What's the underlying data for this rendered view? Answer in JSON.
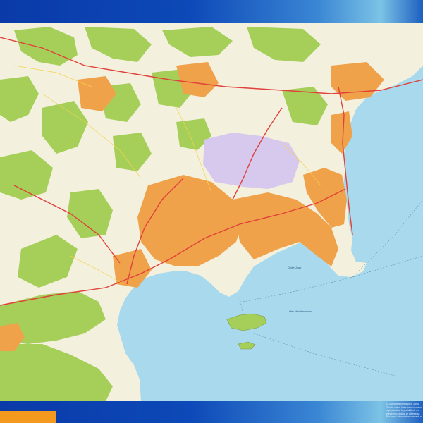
{
  "map": {
    "sea_labels": [
      "Golfe Juan",
      "Mer Méditerranée"
    ],
    "colors": {
      "sea": "#a9d9ec",
      "land": "#f3f0de",
      "forest": "#a6cf5a",
      "urban": "#f0a24a",
      "industrial": "#d7c8ee",
      "roads": "#e0413a",
      "header_blue": "#0d49b8",
      "accent_orange": "#f39a1e"
    }
  },
  "footer": {
    "credits": [
      "© Copyright Netmaps® 1995-",
      "These maps have been created",
      "reproduction is prohibited, ex",
      "electronic, digital or otherwise,",
      "For more information contact: w"
    ]
  }
}
